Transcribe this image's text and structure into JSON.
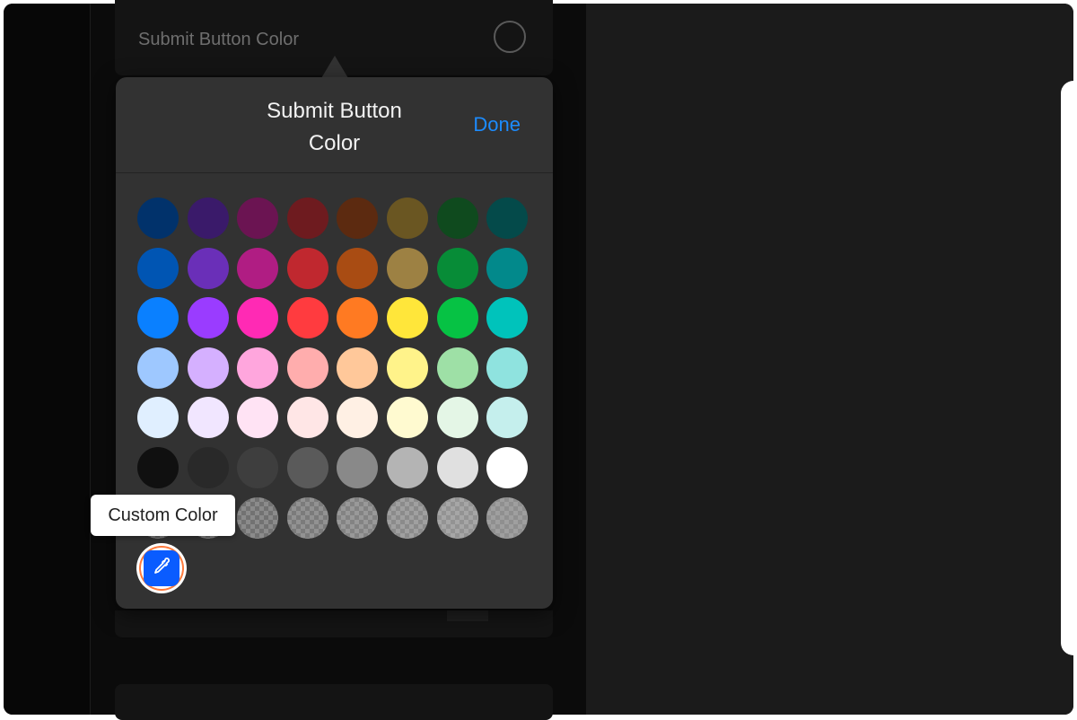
{
  "row": {
    "label": "Submit Button Color"
  },
  "popover": {
    "title_lines": [
      "Submit Button",
      "Color"
    ],
    "done_label": "Done"
  },
  "tooltip": {
    "text": "Custom Color"
  },
  "palette": {
    "rows": [
      [
        "#01326b",
        "#3a1a6a",
        "#6b1452",
        "#6e1b1f",
        "#5c2a10",
        "#6a5622",
        "#0f4a1e",
        "#044a4a"
      ],
      [
        "#0055b3",
        "#6a2fb8",
        "#b01d83",
        "#c0282f",
        "#a94c13",
        "#9d8143",
        "#078c37",
        "#02898b"
      ],
      [
        "#0a80ff",
        "#9a3cff",
        "#ff2ab4",
        "#ff3b3f",
        "#ff7a22",
        "#ffe63a",
        "#06c244",
        "#00c3bb"
      ],
      [
        "#9ec8ff",
        "#d5b0ff",
        "#ffa6dd",
        "#ffadad",
        "#ffc89a",
        "#fff38a",
        "#9ee0a6",
        "#8fe3df"
      ],
      [
        "#e0efff",
        "#f1e6ff",
        "#ffe3f4",
        "#ffe6e6",
        "#fff0e4",
        "#fffad0",
        "#e4f6e6",
        "#c5efed"
      ],
      [
        "#101010",
        "#292929",
        "#3e3e3e",
        "#5a5a5a",
        "#898989",
        "#b4b4b4",
        "#e0e0e0",
        "#ffffff"
      ],
      [
        "transparent",
        "transparent",
        "transparent",
        "transparent",
        "transparent",
        "transparent",
        "transparent",
        "#d0d0d0"
      ]
    ],
    "translucent_row_opacity": [
      0.05,
      0.1,
      0.15,
      0.2,
      0.25,
      0.3,
      0.35,
      0.45
    ]
  },
  "custom_color": {
    "icon": "eyedropper-icon",
    "fill": "#0a5cff",
    "ring": "#ff7a3c"
  },
  "colors": {
    "accent": "#1c8cff",
    "popover_bg": "#323232"
  }
}
